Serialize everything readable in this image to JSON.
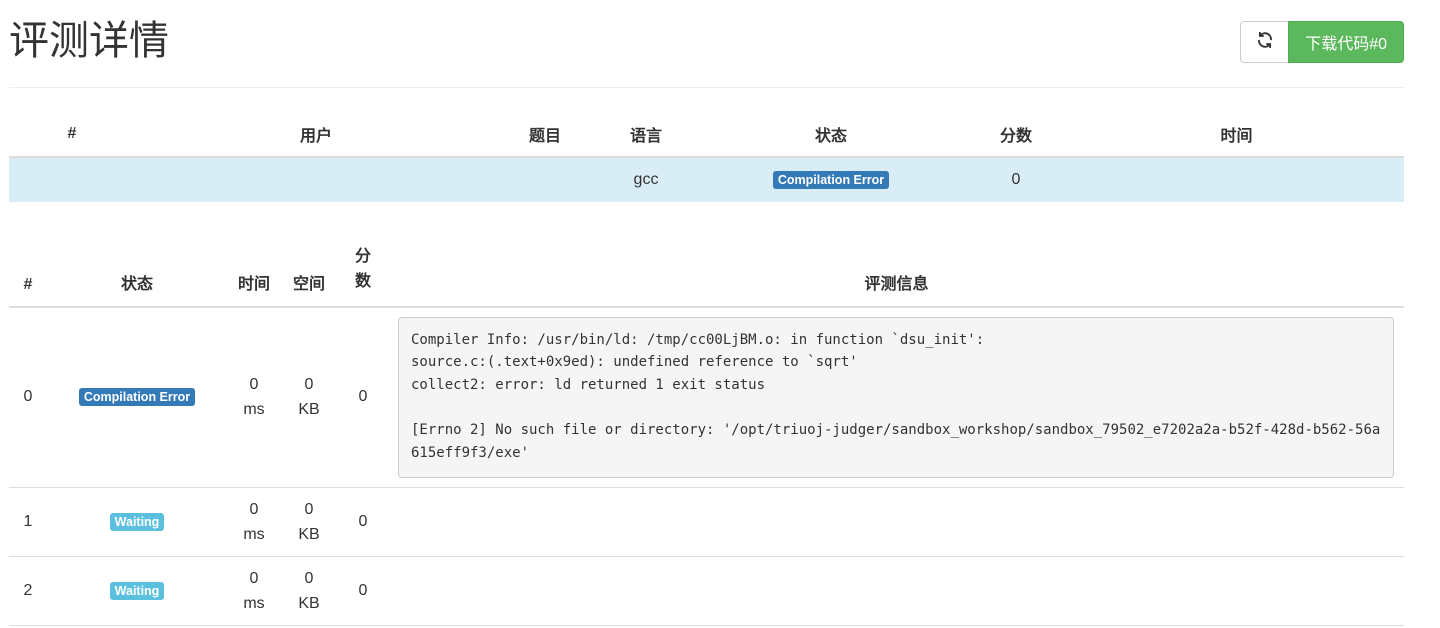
{
  "page": {
    "title": "评测详情",
    "download_label": "下载代码#0",
    "refresh_icon": "refresh-icon"
  },
  "summary": {
    "headers": {
      "id": "#",
      "user": "用户",
      "problem": "题目",
      "language": "语言",
      "status": "状态",
      "score": "分数",
      "time": "时间"
    },
    "row": {
      "id": "",
      "user": "",
      "problem": "",
      "language": "gcc",
      "status": "Compilation Error",
      "score": "0",
      "time": ""
    }
  },
  "details": {
    "headers": {
      "id": "#",
      "status": "状态",
      "time": "时间",
      "memory": "空间",
      "score_line1": "分",
      "score_line2": "数",
      "info": "评测信息"
    },
    "rows": [
      {
        "id": "0",
        "status": "Compilation Error",
        "time_value": "0",
        "time_unit": "ms",
        "mem_value": "0",
        "mem_unit": "KB",
        "score": "0",
        "message": "Compiler Info: /usr/bin/ld: /tmp/cc00LjBM.o: in function `dsu_init':\nsource.c:(.text+0x9ed): undefined reference to `sqrt'\ncollect2: error: ld returned 1 exit status\n\n[Errno 2] No such file or directory: '/opt/triuoj-judger/sandbox_workshop/sandbox_79502_e7202a2a-b52f-428d-b562-56a615eff9f3/exe'"
      },
      {
        "id": "1",
        "status": "Waiting",
        "time_value": "0",
        "time_unit": "ms",
        "mem_value": "0",
        "mem_unit": "KB",
        "score": "0"
      },
      {
        "id": "2",
        "status": "Waiting",
        "time_value": "0",
        "time_unit": "ms",
        "mem_value": "0",
        "mem_unit": "KB",
        "score": "0"
      }
    ]
  },
  "colors": {
    "success": "#5cb85c",
    "primary": "#337ab7",
    "info": "#5bc0de",
    "row_highlight": "#d9edf7"
  }
}
